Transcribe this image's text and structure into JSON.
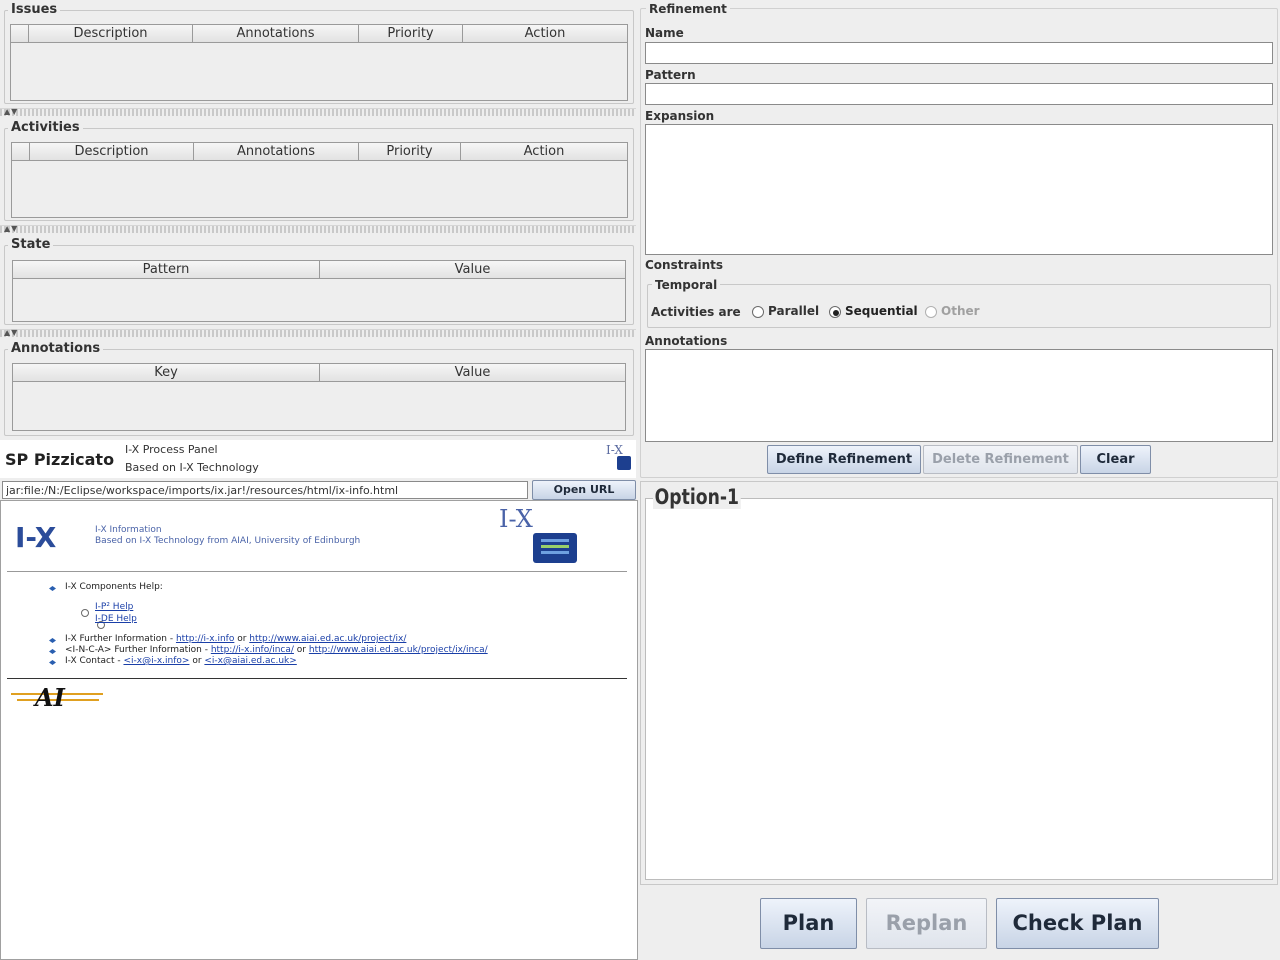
{
  "issues": {
    "title": "Issues",
    "columns": [
      "Description",
      "Annotations",
      "Priority",
      "Action"
    ]
  },
  "activities": {
    "title": "Activities",
    "columns": [
      "Description",
      "Annotations",
      "Priority",
      "Action"
    ]
  },
  "state": {
    "title": "State",
    "columns": [
      "Pattern",
      "Value"
    ]
  },
  "annotations_panel": {
    "title": "Annotations",
    "columns": [
      "Key",
      "Value"
    ]
  },
  "agent": {
    "name": "SP Pizzicato",
    "line1": "I-X Process Panel",
    "line2": "Based on I-X Technology",
    "logo_text": "I-X"
  },
  "url_bar": {
    "value": "jar:file:/N:/Eclipse/workspace/imports/ix.jar!/resources/html/ix-info.html",
    "button": "Open URL"
  },
  "info_page": {
    "logo": "I-X",
    "heading": "I-X Information",
    "subheading": "Based on I-X Technology from AIAI, University of Edinburgh",
    "logo_right": "I-X",
    "components_help": "I-X Components Help:",
    "ip2_help": "I-P² Help",
    "ide_help": "I-DE Help",
    "further_info_prefix": "I-X Further Information - ",
    "further_info_link1": "http://i-x.info",
    "further_info_or": " or ",
    "further_info_link2": "http://www.aiai.ed.ac.uk/project/ix/",
    "inca_prefix": "<I-N-C-A> Further Information - ",
    "inca_link1": "http://i-x.info/inca/",
    "inca_or": " or ",
    "inca_link2": "http://www.aiai.ed.ac.uk/project/ix/inca/",
    "contact_prefix": "I-X Contact - ",
    "contact_link1": "<i-x@i-x.info>",
    "contact_or": " or ",
    "contact_link2": "<i-x@aiai.ed.ac.uk>",
    "aiai_logo": "AI"
  },
  "refinement": {
    "title": "Refinement",
    "name_label": "Name",
    "name_value": "",
    "pattern_label": "Pattern",
    "pattern_value": "",
    "expansion_label": "Expansion",
    "constraints_label": "Constraints",
    "temporal_title": "Temporal",
    "activities_are": "Activities are",
    "opt_parallel": "Parallel",
    "opt_sequential": "Sequential",
    "opt_other": "Other",
    "selected": "Sequential",
    "annotations_label": "Annotations",
    "define_button": "Define Refinement",
    "delete_button": "Delete Refinement",
    "clear_button": "Clear"
  },
  "option": {
    "title": "Option-1"
  },
  "plan_buttons": {
    "plan": "Plan",
    "replan": "Replan",
    "check_plan": "Check Plan"
  }
}
